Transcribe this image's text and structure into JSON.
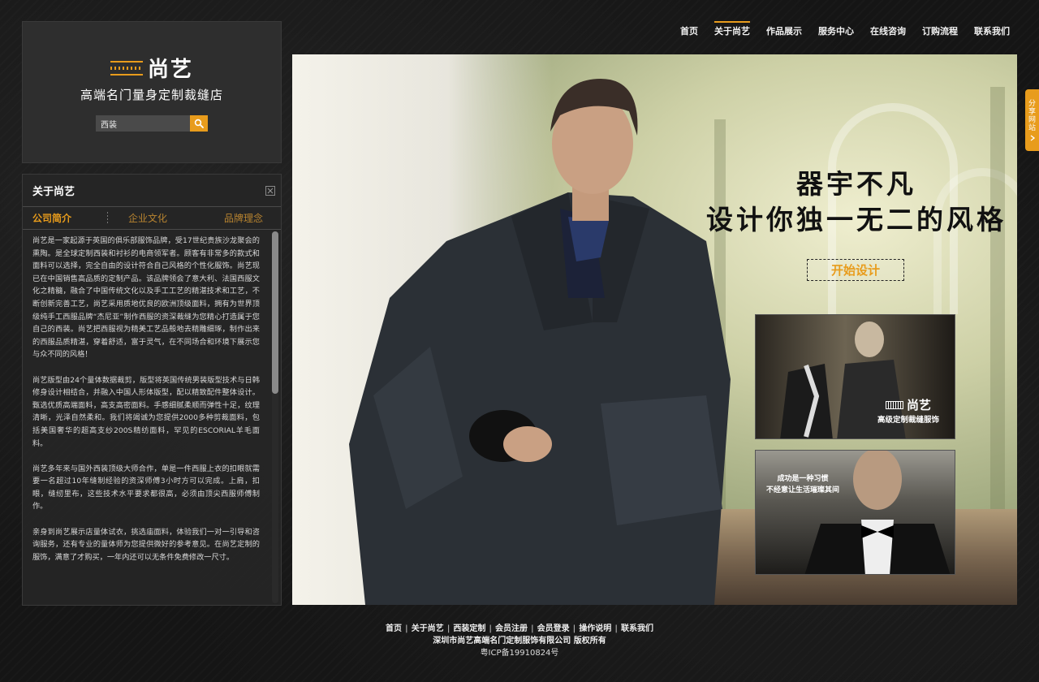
{
  "nav": {
    "items": [
      "首页",
      "关于尚艺",
      "作品展示",
      "服务中心",
      "在线咨询",
      "订购流程",
      "联系我们"
    ],
    "active_index": 1
  },
  "brand": {
    "logo_text": "尚艺",
    "tagline": "高端名门量身定制裁缝店"
  },
  "search": {
    "value": "西装"
  },
  "about": {
    "title": "关于尚艺",
    "tabs": [
      "公司简介",
      "企业文化",
      "品牌理念"
    ],
    "paragraphs": [
      "尚艺是一家起源于英国的俱乐部服饰品牌，受17世纪贵族沙龙聚会的熏陶。是全球定制西装和衬衫的电商领军者。顾客有非常多的款式和面料可以选择，完全自由的设计符合自己风格的个性化服饰。尚艺现已在中国销售高品质的定制产品。该品牌领会了意大利、法国西服文化之精髓，融合了中国传统文化以及手工工艺的精湛技术和工艺，不断创新完善工艺，尚艺采用质地优良的欧洲顶级面料，拥有为世界顶级纯手工西服品牌“杰尼亚”制作西服的资深裁缝为您精心打造属于您自己的西装。尚艺把西服视为精美工艺品般地去精雕细琢，制作出来的西服品质精湛，穿着舒适，富于灵气，在不同场合和环境下展示您与众不同的风格！",
      "尚艺版型由24个量体数据裁剪，版型将英国传统男装版型技术与日韩修身设计相结合，并融入中国人形体版型，配以精致配件整体设计。甄选优质高端面料，高支高密面料。手感细腻柔顺而弹性十足，纹理清晰，光泽自然柔和。我们将竭诚为您提供2000多种剪裁面料，包括美国奢华的超高支纱200S精纺面料，罕见的ESCORIAL羊毛面料。",
      "尚艺多年来与国外西装顶级大师合作，单是一件西服上衣的扣眼就需要一名超过10年缝制经验的资深师傅3小时方可以完成。上肩，扣眼，缝纫里布，这些技术水平要求都很高，必须由顶尖西服师傅制作。",
      "亲身到尚艺展示店量体试衣，挑选庙面料，体验我们一对一引导和咨询服务，还有专业的量体师为您提供微好的参考意见。在尚艺定制的服饰，满意了才购买，一年内还可以无条件免费修改一尺寸。"
    ],
    "scroll_fraction": 0.0
  },
  "banner": {
    "headline_1": "器宇不凡",
    "headline_2": "设计你独一无二的风格",
    "cta_label": "开始设计",
    "promo1_logo": "尚艺",
    "promo1_sub": "高级定制裁缝服饰",
    "promo2_line1": "成功是一种习惯",
    "promo2_line2": "不经意让生活璀璨其间"
  },
  "share_tab": {
    "label": "分享网站"
  },
  "footer": {
    "links": [
      "首页",
      "关于尚艺",
      "西装定制",
      "会员注册",
      "会员登录",
      "操作说明",
      "联系我们"
    ],
    "company": "深圳市尚艺高端名门定制服饰有限公司 版权所有",
    "icp": "粤ICP备19910824号"
  },
  "colors": {
    "accent": "#e89c1c",
    "panel_bg": "#303030",
    "page_bg": "#151515"
  }
}
